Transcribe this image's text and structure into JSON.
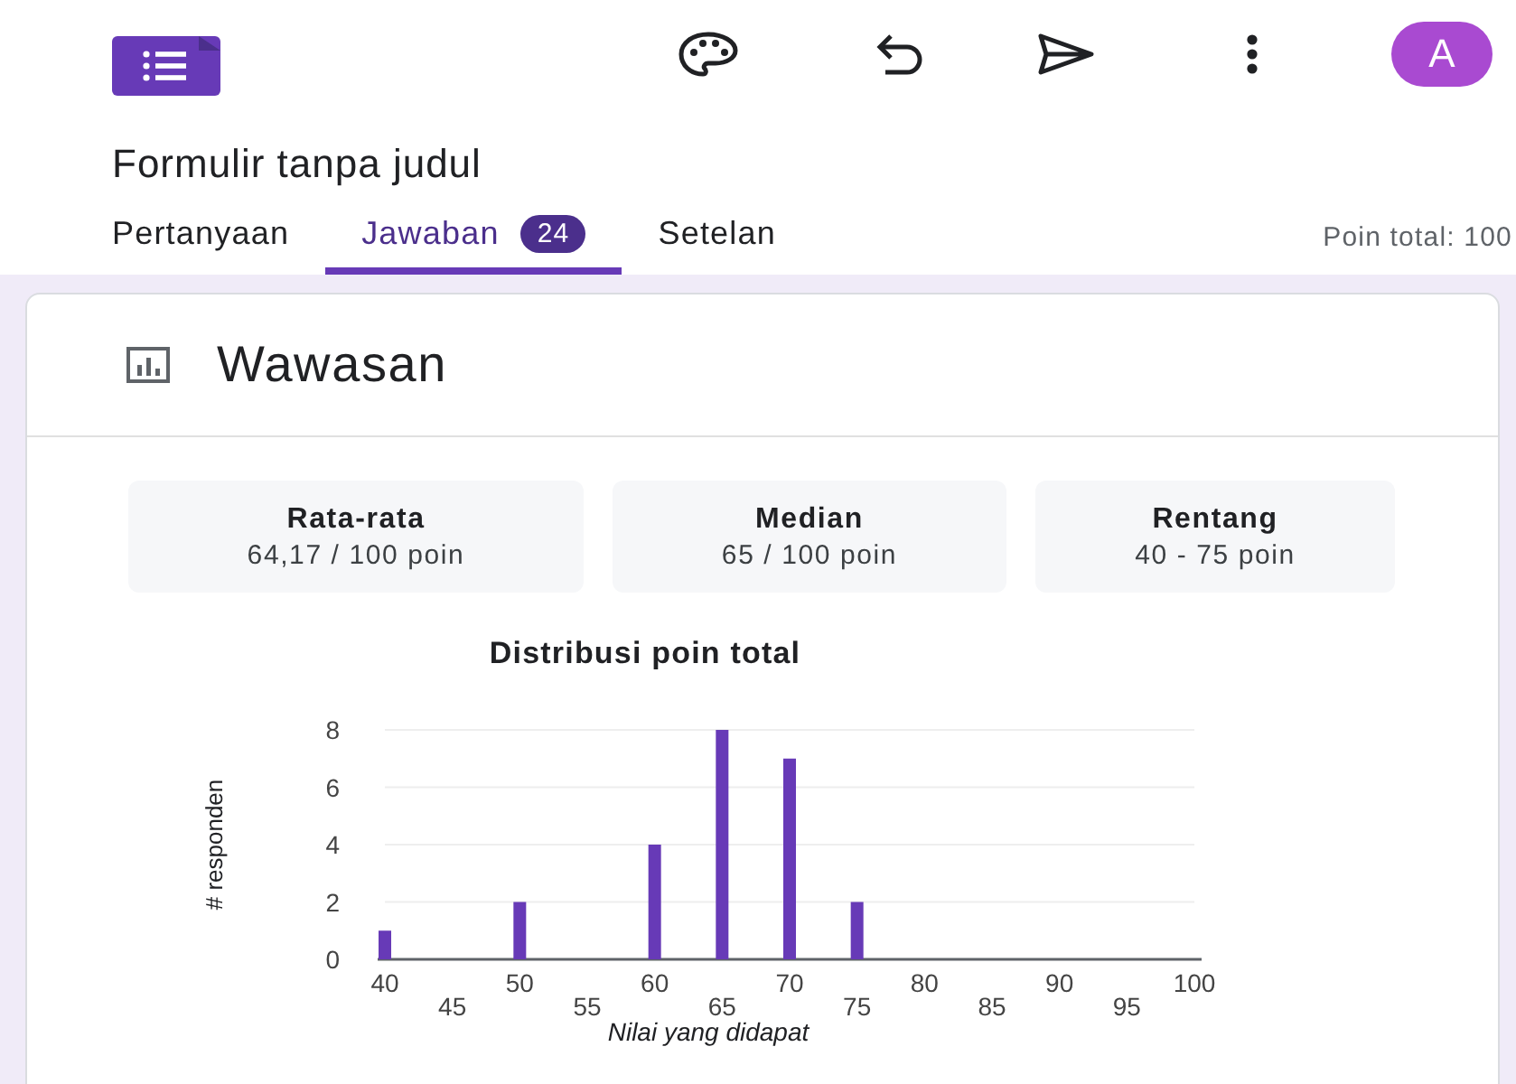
{
  "app_bar": {
    "avatar": "A"
  },
  "form_title": "Formulir tanpa judul",
  "tabs": [
    {
      "label": "Pertanyaan",
      "selected": false
    },
    {
      "label": "Jawaban",
      "selected": true,
      "badge": "24"
    },
    {
      "label": "Setelan",
      "selected": false
    }
  ],
  "total_points": "Poin total: 100",
  "insights": {
    "title": "Wawasan",
    "stats": [
      {
        "label": "Rata-rata",
        "value": "64,17 / 100 poin"
      },
      {
        "label": "Median",
        "value": "65 / 100 poin"
      },
      {
        "label": "Rentang",
        "value": "40 - 75 poin"
      }
    ],
    "chart_data": {
      "type": "bar",
      "title": "Distribusi poin total",
      "xlabel": "Nilai yang didapat",
      "ylabel": "# responden",
      "categories": [
        "40",
        "45",
        "50",
        "55",
        "60",
        "65",
        "70",
        "75",
        "80",
        "85",
        "90",
        "95",
        "100"
      ],
      "values": [
        1,
        0,
        2,
        0,
        4,
        8,
        7,
        2,
        0,
        0,
        0,
        0,
        0
      ],
      "color": "#673ab7",
      "ylim": [
        0,
        8
      ],
      "yticks": [
        0,
        2,
        4,
        6,
        8
      ],
      "grid": true
    }
  }
}
